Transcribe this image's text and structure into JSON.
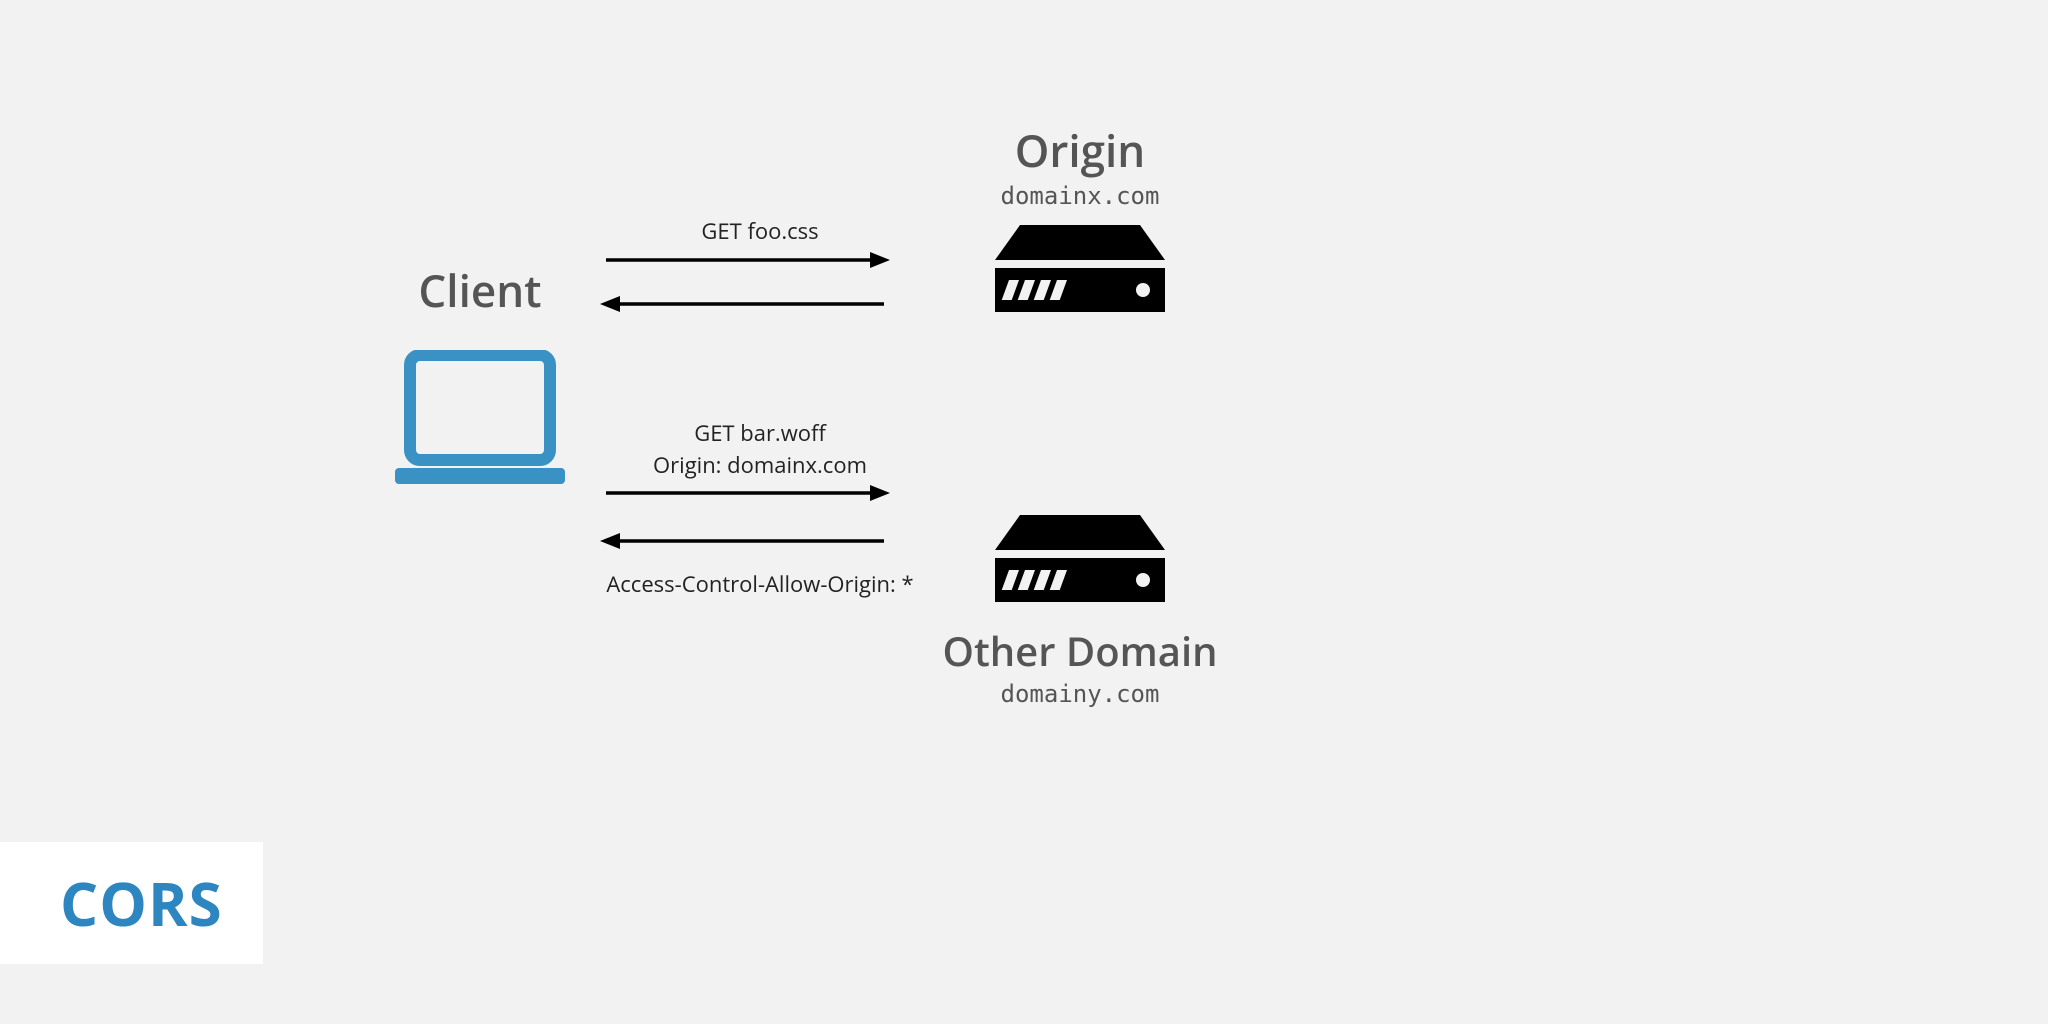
{
  "client": {
    "label": "Client"
  },
  "origin": {
    "title": "Origin",
    "subtitle": "domainx.com"
  },
  "other": {
    "title": "Other Domain",
    "subtitle": "domainy.com"
  },
  "arrows": {
    "top_request": "GET foo.css",
    "bottom_request_line1": "GET bar.woff",
    "bottom_request_line2": "Origin: domainx.com",
    "bottom_response": "Access-Control-Allow-Origin: *"
  },
  "footer": {
    "label": "CORS"
  },
  "colors": {
    "accent": "#2e86c1",
    "text": "#555555"
  }
}
